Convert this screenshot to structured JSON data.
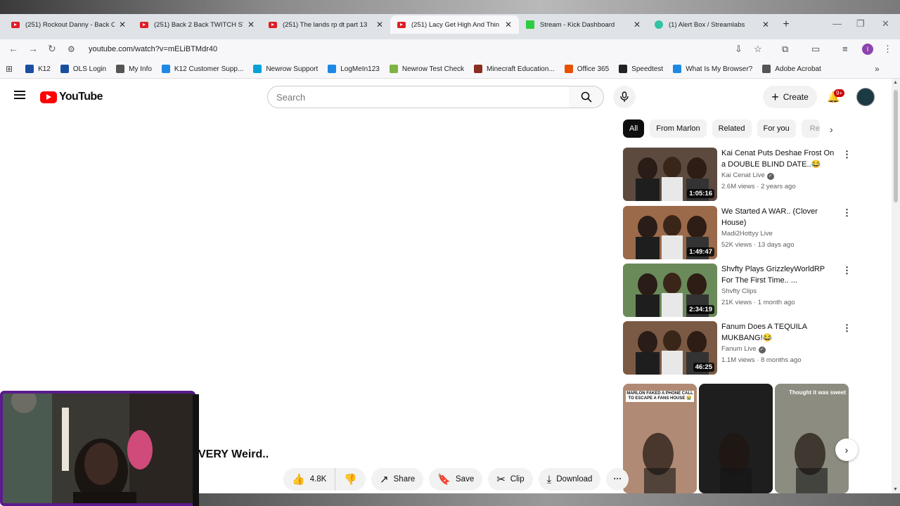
{
  "browser": {
    "tabs": [
      {
        "label": "(251) Rockout Danny - Back C",
        "icon": "youtube-favicon"
      },
      {
        "label": "(251) Back 2 Back TWITCH ST",
        "icon": "youtube-favicon"
      },
      {
        "label": "(251) The lands rp dt part 13",
        "icon": "youtube-favicon"
      },
      {
        "label": "(251) Lacy Get High And Thin",
        "icon": "youtube-favicon",
        "active": true
      },
      {
        "label": "Stream - Kick Dashboard",
        "icon": "kick-favicon"
      },
      {
        "label": "(1) Alert Box / Streamlabs",
        "icon": "streamlabs-favicon"
      }
    ],
    "url": "youtube.com/watch?v=mELiBTMdr40",
    "profile_initial": "I",
    "bookmarks": [
      {
        "label": "K12",
        "color": "#1a4fa0"
      },
      {
        "label": "OLS Login",
        "color": "#1a4fa0"
      },
      {
        "label": "My Info",
        "color": "#555555"
      },
      {
        "label": "K12 Customer Supp...",
        "color": "#1e88e5"
      },
      {
        "label": "Newrow Support",
        "color": "#0aa0d8"
      },
      {
        "label": "LogMeIn123",
        "color": "#1e88e5"
      },
      {
        "label": "Newrow Test Check",
        "color": "#7cb342"
      },
      {
        "label": "Minecraft Education...",
        "color": "#8b2d1f"
      },
      {
        "label": "Office 365",
        "color": "#e65100"
      },
      {
        "label": "Speedtest",
        "color": "#222222"
      },
      {
        "label": "What Is My Browser?",
        "color": "#1e88e5"
      },
      {
        "label": "Adobe Acrobat",
        "color": "#555555"
      }
    ]
  },
  "youtube": {
    "logo_text": "YouTube",
    "search_placeholder": "Search",
    "create_label": "Create",
    "notif_badge": "9+",
    "chips": [
      "All",
      "From Marlon",
      "Related",
      "For you",
      "Re"
    ],
    "recommended": [
      {
        "title": "Kai Cenat Puts Deshae Frost On a DOUBLE BLIND DATE..😂",
        "channel": "Kai Cenat Live",
        "verified": true,
        "meta": "2.6M views · 2 years ago",
        "duration": "1:05:16",
        "thumb_color": "#5c4a3f"
      },
      {
        "title": "We Started A WAR.. (Clover House)",
        "channel": "Madi2Hottyy Live",
        "verified": false,
        "meta": "52K views · 13 days ago",
        "duration": "1:49:47",
        "thumb_color": "#9a6a4a"
      },
      {
        "title": "Shvfty Plays GrizzleyWorldRP For The First Time.. ...",
        "channel": "Shvfty Clips",
        "verified": false,
        "meta": "21K views · 1 month ago",
        "duration": "2:34:19",
        "thumb_color": "#6b8a5a"
      },
      {
        "title": "Fanum Does A TEQUILA MUKBANG!😂",
        "channel": "Fanum Live",
        "verified": true,
        "meta": "1.1M views · 8 months ago",
        "duration": "46:25",
        "thumb_color": "#7a5a44"
      }
    ],
    "shorts": [
      {
        "caption": "MARLON FAKED A PHONE CALL TO ESCAPE A FANS HOUSE 😭",
        "color": "#b08a74"
      },
      {
        "caption": "",
        "color": "#1e1e1e"
      },
      {
        "caption": "Thought it was sweet",
        "color": "#8c8c80"
      }
    ],
    "video_title_visible": "VERY Weird..",
    "like_count": "4.8K",
    "share_label": "Share",
    "save_label": "Save",
    "clip_label": "Clip",
    "download_label": "Download"
  }
}
